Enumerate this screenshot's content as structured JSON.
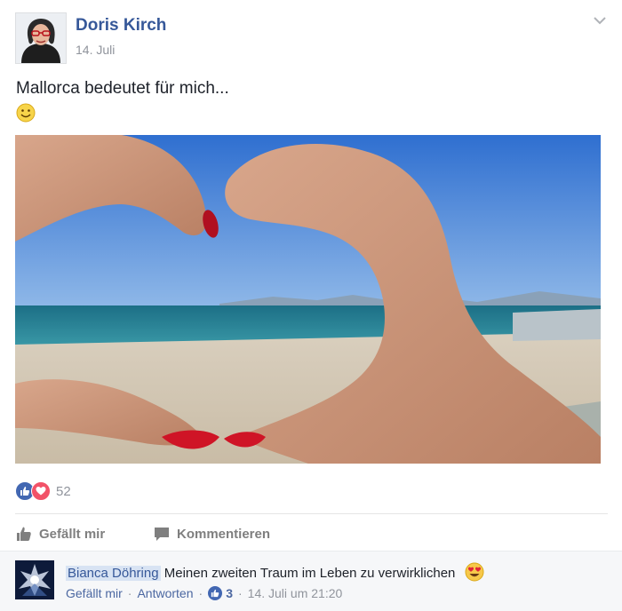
{
  "post": {
    "author": "Doris Kirch",
    "date": "14. Juli",
    "text": "Mallorca bedeutet für mich...",
    "text_emoji": "smile-emoji",
    "reaction_count": "52",
    "reaction_icons": [
      "like-icon",
      "love-icon"
    ]
  },
  "actions": {
    "like_label": "Gefällt mir",
    "comment_label": "Kommentieren"
  },
  "comment": {
    "author": "Bianca Döhring",
    "text": "Meinen zweiten Traum im Leben zu verwirklichen",
    "emoji": "heart-eyes-emoji",
    "like_label": "Gefällt mir",
    "reply_label": "Antworten",
    "likes": "3",
    "timestamp": "14. Juli um 21:20"
  },
  "colors": {
    "link": "#365899",
    "like_blue": "#4267b2",
    "love_red": "#f25268",
    "meta_gray": "#90949c"
  }
}
